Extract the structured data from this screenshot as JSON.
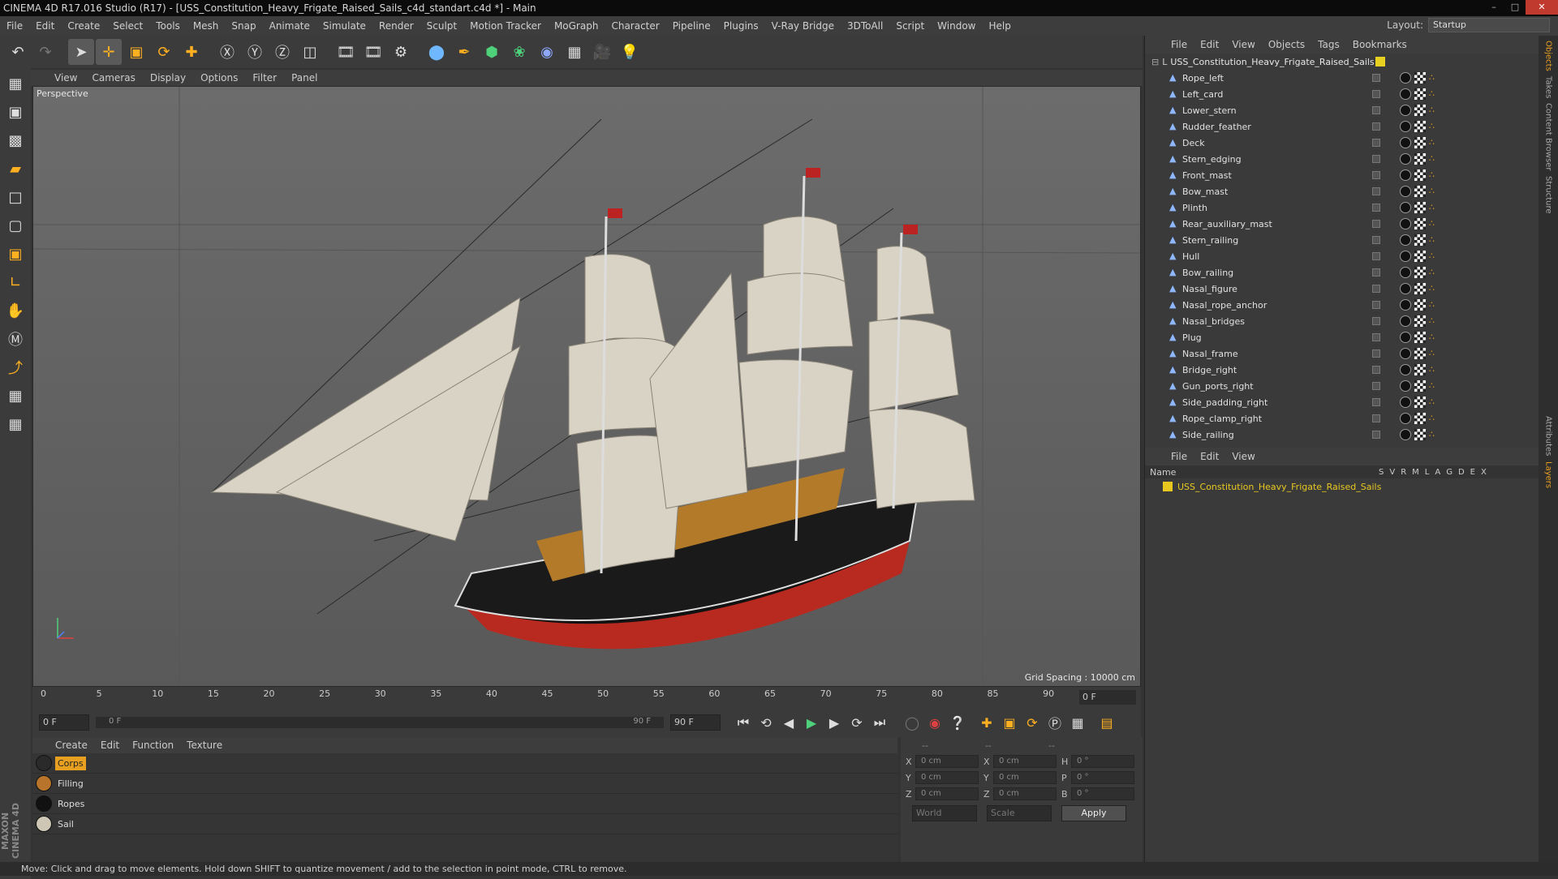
{
  "window": {
    "title": "CINEMA 4D R17.016 Studio (R17) - [USS_Constitution_Heavy_Frigate_Raised_Sails_c4d_standart.c4d *] - Main"
  },
  "menubar": {
    "items": [
      "File",
      "Edit",
      "Create",
      "Select",
      "Tools",
      "Mesh",
      "Snap",
      "Animate",
      "Simulate",
      "Render",
      "Sculpt",
      "Motion Tracker",
      "MoGraph",
      "Character",
      "Pipeline",
      "Plugins",
      "V-Ray Bridge",
      "3DToAll",
      "Script",
      "Window",
      "Help"
    ],
    "layout_label": "Layout:",
    "layout_value": "Startup"
  },
  "viewport": {
    "menu": [
      "View",
      "Cameras",
      "Display",
      "Options",
      "Filter",
      "Panel"
    ],
    "label": "Perspective",
    "grid_spacing": "Grid Spacing : 10000 cm"
  },
  "timeline": {
    "ticks": [
      "0",
      "5",
      "10",
      "15",
      "20",
      "25",
      "30",
      "35",
      "40",
      "45",
      "50",
      "55",
      "60",
      "65",
      "70",
      "75",
      "80",
      "85",
      "90"
    ],
    "current_frame": "0 F"
  },
  "playbar": {
    "start": "0 F",
    "range_start": "0 F",
    "range_end": "90 F",
    "end": "90 F"
  },
  "materials": {
    "menu": [
      "Create",
      "Edit",
      "Function",
      "Texture"
    ],
    "items": [
      {
        "name": "Corps",
        "color": "#2a2a2a"
      },
      {
        "name": "Filling",
        "color": "#b8742a"
      },
      {
        "name": "Ropes",
        "color": "#111111"
      },
      {
        "name": "Sail",
        "color": "#cfc7b5"
      }
    ]
  },
  "coords": {
    "header": [
      "--",
      "--",
      "--"
    ],
    "rows": [
      {
        "a": "X",
        "v1": "0 cm",
        "b": "X",
        "v2": "0 cm",
        "c": "H",
        "v3": "0 °"
      },
      {
        "a": "Y",
        "v1": "0 cm",
        "b": "Y",
        "v2": "0 cm",
        "c": "P",
        "v3": "0 °"
      },
      {
        "a": "Z",
        "v1": "0 cm",
        "b": "Z",
        "v2": "0 cm",
        "c": "B",
        "v3": "0 °"
      }
    ],
    "world": "World",
    "scale": "Scale",
    "apply": "Apply"
  },
  "objects": {
    "menu": [
      "File",
      "Edit",
      "View",
      "Objects",
      "Tags",
      "Bookmarks"
    ],
    "root": "USS_Constitution_Heavy_Frigate_Raised_Sails",
    "items": [
      "Rope_left",
      "Left_card",
      "Lower_stern",
      "Rudder_feather",
      "Deck",
      "Stern_edging",
      "Front_mast",
      "Bow_mast",
      "Plinth",
      "Rear_auxiliary_mast",
      "Stern_railing",
      "Hull",
      "Bow_railing",
      "Nasal_figure",
      "Nasal_rope_anchor",
      "Nasal_bridges",
      "Plug",
      "Nasal_frame",
      "Bridge_right",
      "Gun_ports_right",
      "Side_padding_right",
      "Rope_clamp_right",
      "Side_railing"
    ]
  },
  "layers": {
    "menu": [
      "File",
      "Edit",
      "View"
    ],
    "columns": [
      "Name",
      "S",
      "V",
      "R",
      "M",
      "L",
      "A",
      "G",
      "D",
      "E",
      "X"
    ],
    "item": "USS_Constitution_Heavy_Frigate_Raised_Sails",
    "item_color": "#e8c820"
  },
  "rightstrip": [
    "Objects",
    "Takes",
    "Content Browser",
    "Structure",
    "Attributes",
    "Layers"
  ],
  "status": "Move: Click and drag to move elements. Hold down SHIFT to quantize movement / add to the selection in point mode, CTRL to remove.",
  "brand": "MAXON CINEMA 4D"
}
